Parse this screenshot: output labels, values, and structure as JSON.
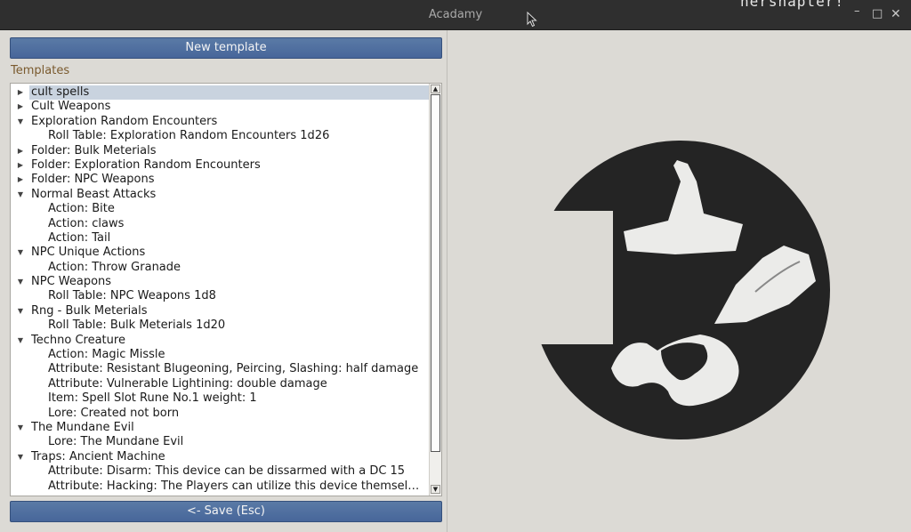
{
  "window": {
    "title": "Acadamy",
    "bg_text": "hersnapter!",
    "controls": {
      "minimize": "–",
      "maximize": "□",
      "close": "✕"
    }
  },
  "toolbar": {
    "new_template_label": "New template",
    "save_label": "<- Save (Esc)"
  },
  "templates": {
    "section_label": "Templates",
    "items": [
      {
        "label": "cult spells",
        "level": 0,
        "arrow": "collapsed",
        "selected": true
      },
      {
        "label": "Cult Weapons",
        "level": 0,
        "arrow": "collapsed"
      },
      {
        "label": "Exploration Random Encounters",
        "level": 0,
        "arrow": "expanded"
      },
      {
        "label": "Roll Table: Exploration Random Encounters 1d26",
        "level": 1
      },
      {
        "label": "Folder: Bulk Meterials",
        "level": 0,
        "arrow": "collapsed"
      },
      {
        "label": "Folder: Exploration Random Encounters",
        "level": 0,
        "arrow": "collapsed"
      },
      {
        "label": "Folder: NPC Weapons",
        "level": 0,
        "arrow": "collapsed"
      },
      {
        "label": "Normal Beast Attacks",
        "level": 0,
        "arrow": "expanded"
      },
      {
        "label": "Action: Bite",
        "level": 1
      },
      {
        "label": "Action: claws",
        "level": 1
      },
      {
        "label": "Action: Tail",
        "level": 1
      },
      {
        "label": "NPC Unique Actions",
        "level": 0,
        "arrow": "expanded"
      },
      {
        "label": "Action: Throw Granade",
        "level": 1
      },
      {
        "label": "NPC Weapons",
        "level": 0,
        "arrow": "expanded"
      },
      {
        "label": "Roll Table: NPC Weapons 1d8",
        "level": 1
      },
      {
        "label": "Rng - Bulk Meterials",
        "level": 0,
        "arrow": "expanded"
      },
      {
        "label": "Roll Table: Bulk Meterials 1d20",
        "level": 1
      },
      {
        "label": "Techno Creature",
        "level": 0,
        "arrow": "expanded"
      },
      {
        "label": "Action: Magic Missle",
        "level": 1
      },
      {
        "label": "Attribute: Resistant Blugeoning, Peircing, Slashing: half damage",
        "level": 1
      },
      {
        "label": "Attribute: Vulnerable Lightining: double damage",
        "level": 1
      },
      {
        "label": "Item: Spell Slot Rune No.1 weight: 1",
        "level": 1
      },
      {
        "label": "Lore: Created not born",
        "level": 1
      },
      {
        "label": "The Mundane Evil",
        "level": 0,
        "arrow": "expanded"
      },
      {
        "label": "Lore: The Mundane Evil",
        "level": 1
      },
      {
        "label": "Traps: Ancient Machine",
        "level": 0,
        "arrow": "expanded"
      },
      {
        "label": "Attribute: Disarm: This device can be dissarmed with a DC 15",
        "level": 1
      },
      {
        "label": "Attribute: Hacking: The Players can utilize this device themselve…",
        "level": 1
      }
    ]
  },
  "icons": {
    "expanded": "triangle-down-icon",
    "collapsed": "triangle-right-icon",
    "scroll_up": "▲",
    "scroll_down": "▼"
  },
  "colors": {
    "button": "#4d6c9f",
    "section_label": "#7a5a2e",
    "panel_bg": "#dcdad5",
    "selection": "#c9d3df"
  }
}
